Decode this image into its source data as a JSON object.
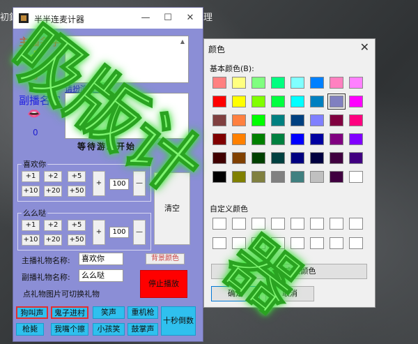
{
  "desktop": {
    "corner_text_left": "初欽",
    "corner_text_right": "理"
  },
  "main_window": {
    "title": "半半连麦计器",
    "controls": {
      "minimize": "—",
      "maximize": "☐",
      "close": "✕"
    },
    "host": {
      "label": "主播名字",
      "emoji": "🤞",
      "count": "0"
    },
    "cohost": {
      "label": "副播名字",
      "emoji": "👄",
      "count": "0"
    },
    "link_text": "请扮演者 ...",
    "status": "等待游戏开始",
    "group1": {
      "title": "喜欢你",
      "row1": [
        "+1",
        "+2",
        "+5"
      ],
      "row2": [
        "+10",
        "+20",
        "+50"
      ],
      "plus": "+",
      "value": "100",
      "minus": "—"
    },
    "group2": {
      "title": "么么哒",
      "row1": [
        "+1",
        "+2",
        "+5"
      ],
      "row2": [
        "+10",
        "+20",
        "+50"
      ],
      "plus": "+",
      "value": "100",
      "minus": "—"
    },
    "clear_label": "清空",
    "host_gift_label": "主播礼物名称:",
    "host_gift_value": "喜欢你",
    "cohost_gift_label": "副播礼物名称:",
    "cohost_gift_value": "么么哒",
    "bg_color_label": "背景颜色",
    "hint": "点礼物图片可切换礼物",
    "stop_label": "停止播放",
    "sounds_row1": [
      "狗叫声",
      "鬼子进村",
      "笑声",
      "重机枪"
    ],
    "sounds_row2": [
      "枪毙",
      "我嘴个擦",
      "小孩笑",
      "鼓掌声"
    ],
    "countdown_label": "十秒倒数"
  },
  "color_dialog": {
    "title": "颜色",
    "close": "✕",
    "basic_label": "基本颜色(B):",
    "custom_label": "自定义颜色",
    "define_button": "规定自定义颜色",
    "ok": "确定",
    "cancel": "取消",
    "basic_colors": [
      "#ff8080",
      "#ffff80",
      "#80ff80",
      "#00ff80",
      "#80ffff",
      "#0080ff",
      "#ff80c0",
      "#ff80ff",
      "#ff0000",
      "#ffff00",
      "#80ff00",
      "#00ff40",
      "#00ffff",
      "#0080c0",
      "#8080c0",
      "#ff00ff",
      "#804040",
      "#ff8040",
      "#00ff00",
      "#008080",
      "#004080",
      "#8080ff",
      "#800040",
      "#ff0080",
      "#800000",
      "#ff8000",
      "#008000",
      "#008040",
      "#0000ff",
      "#0000a0",
      "#800080",
      "#8000ff",
      "#400000",
      "#804000",
      "#004000",
      "#004040",
      "#000080",
      "#000040",
      "#400040",
      "#400080",
      "#000000",
      "#808000",
      "#808040",
      "#808080",
      "#408080",
      "#c0c0c0",
      "#400040",
      "#ffffff"
    ],
    "selected_index": 14
  },
  "watermark": {
    "line1": "吸版计",
    "line2": "器"
  }
}
